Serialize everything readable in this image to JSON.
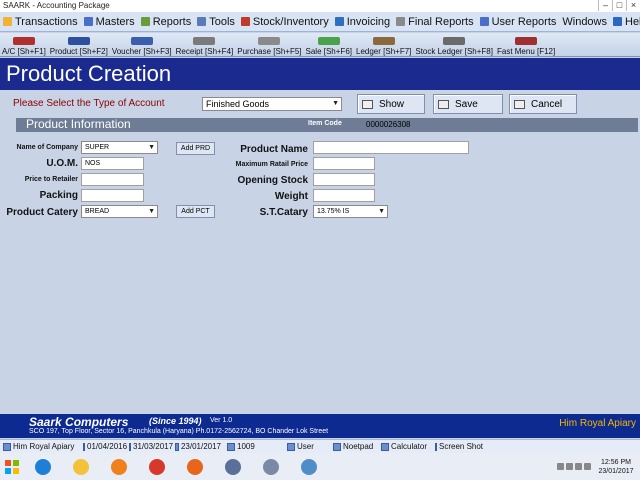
{
  "window": {
    "title": "SAARK - Accounting Package"
  },
  "menu": [
    {
      "label": "Transactions",
      "icon": "transactions-icon",
      "color": "#f2b233"
    },
    {
      "label": "Masters",
      "icon": "masters-icon",
      "color": "#4a6ec9"
    },
    {
      "label": "Reports",
      "icon": "reports-icon",
      "color": "#6a9c3c"
    },
    {
      "label": "Tools",
      "icon": "tools-icon",
      "color": "#5b7ab8"
    },
    {
      "label": "Stock/Inventory",
      "icon": "stock-icon",
      "color": "#c0392b"
    },
    {
      "label": "Invoicing",
      "icon": "invoicing-icon",
      "color": "#2e6fbf"
    },
    {
      "label": "Final Reports",
      "icon": "final-reports-icon",
      "color": "#8a8a8a"
    },
    {
      "label": "User Reports",
      "icon": "user-reports-icon",
      "color": "#4a6ec9"
    },
    {
      "label": "Windows",
      "icon": "",
      "color": ""
    },
    {
      "label": "Help",
      "icon": "help-icon",
      "color": "#2b66c2"
    }
  ],
  "toolbar": [
    {
      "label": "A/C [Sh+F1]",
      "icon": "accounts-icon",
      "color": "#b03030"
    },
    {
      "label": "Product [Sh+F2]",
      "icon": "product-icon",
      "color": "#2c4f9e"
    },
    {
      "label": "Voucher [Sh+F3]",
      "icon": "voucher-icon",
      "color": "#3b5fae"
    },
    {
      "label": "Receipt [Sh+F4]",
      "icon": "receipt-icon",
      "color": "#7a7a7a"
    },
    {
      "label": "Purchase [Sh+F5]",
      "icon": "purchase-icon",
      "color": "#8a8a8a"
    },
    {
      "label": "Sale [Sh+F6]",
      "icon": "sale-icon",
      "color": "#4aa34a"
    },
    {
      "label": "Ledger [Sh+F7]",
      "icon": "ledger-icon",
      "color": "#8a6a3a"
    },
    {
      "label": "Stock Ledger [Sh+F8]",
      "icon": "stock-ledger-icon",
      "color": "#6a6a6a"
    },
    {
      "label": "Fast Menu [F12]",
      "icon": "fast-menu-icon",
      "color": "#a03030"
    }
  ],
  "page": {
    "title": "Product Creation"
  },
  "account_type": {
    "label": "Please Select the Type of Account",
    "value": "Finished Goods"
  },
  "buttons": {
    "show": "Show",
    "save": "Save",
    "cancel": "Cancel"
  },
  "info": {
    "title": "Product Information",
    "item_code_label": "Item Code",
    "item_code": "0000026308"
  },
  "form": {
    "name_of_company_label": "Name of Company",
    "name_of_company": "SUPER",
    "add_prd": "Add PRD",
    "uom_label": "U.O.M.",
    "uom": "NOS",
    "price_to_retailer_label": "Price to Retailer",
    "price_to_retailer": "",
    "packing_label": "Packing",
    "packing": "",
    "product_category_label": "Product Catery",
    "product_category": "BREAD",
    "add_pct": "Add PCT",
    "product_name_label": "Product Name",
    "product_name": "",
    "mrp_label": "Maximum Ratail Price",
    "mrp": "",
    "opening_stock_label": "Opening Stock",
    "opening_stock": "",
    "weight_label": "Weight",
    "weight": "",
    "st_category_label": "S.T.Catary",
    "st_category": "13.75% IS"
  },
  "footer": {
    "company": "Saark Computers",
    "since": "(Since 1994)",
    "version": "Ver 1.0",
    "address": "SCO 197, Top Floor, Sector 16, Panchkula (Haryana) Ph.0172-2562724,  BO Chander Lok Street",
    "client": "Him Royal Apiary"
  },
  "status": {
    "client": "Him Royal Apiary",
    "date_from": "01/04/2016",
    "date_to": "31/03/2017",
    "today": "23/01/2017",
    "count": "1009",
    "user": "User",
    "notepad": "Noetpad",
    "calculator": "Calculator",
    "screenshot": "Screen Shot"
  },
  "taskbar": {
    "time": "12:56 PM",
    "date": "23/01/2017",
    "icons": [
      "ie-icon",
      "explorer-icon",
      "media-player-icon",
      "chrome-icon",
      "firefox-icon",
      "saark-app-icon",
      "calculator-app-icon",
      "paint-icon"
    ]
  }
}
